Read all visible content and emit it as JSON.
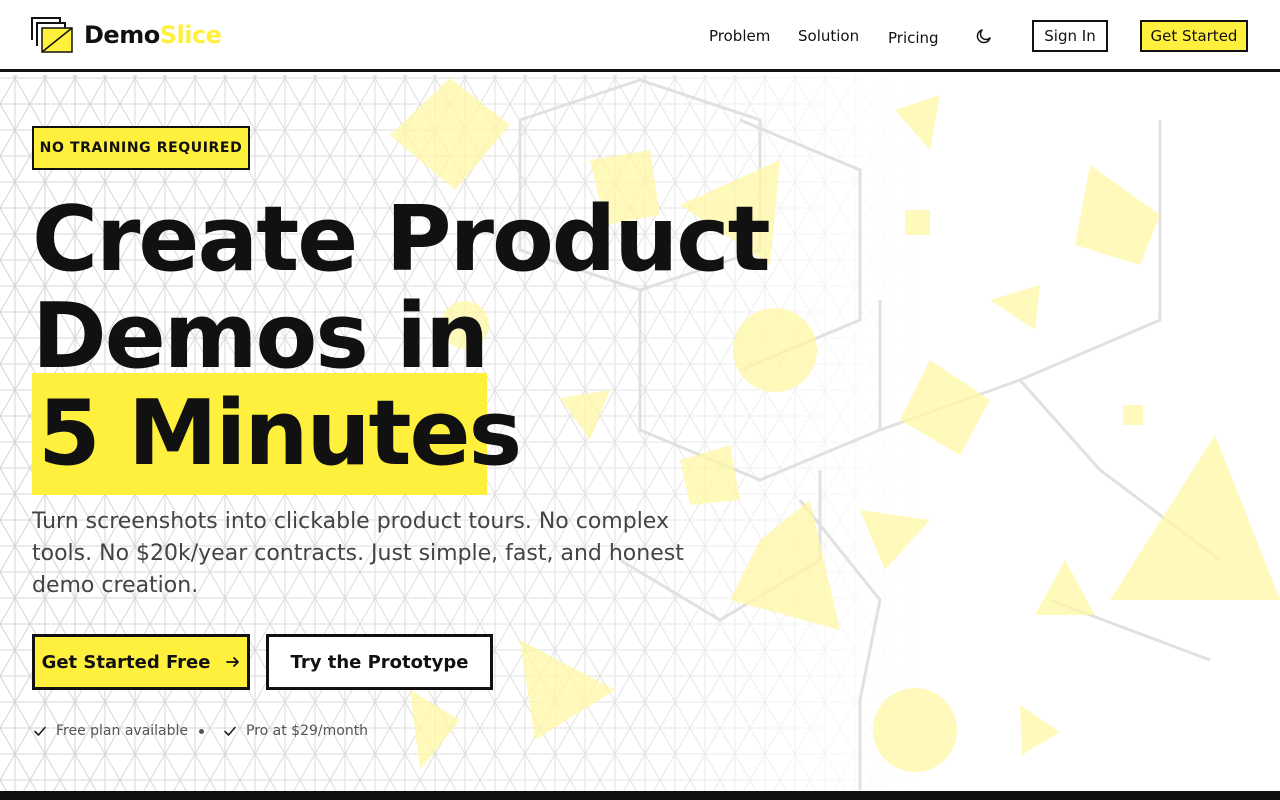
{
  "header": {
    "brand_first": "Demo",
    "brand_second": "Slice",
    "nav": [
      "Problem",
      "Solution",
      "Pricing"
    ],
    "sign_in": "Sign In",
    "get_started": "Get Started"
  },
  "hero": {
    "badge": "NO TRAINING REQUIRED",
    "headline_line1": "Create Product",
    "headline_line2": "Demos in",
    "headline_highlight": "5 Minutes",
    "subtitle": "Turn screenshots into clickable product tours. No complex tools. No $20k/year contracts. Just simple, fast, and honest demo creation.",
    "cta_primary": "Get Started Free",
    "cta_secondary": "Try the Prototype",
    "features": [
      "Free plan available",
      "Pro at $29/month"
    ]
  },
  "icons": {
    "logo": "stacked-frames-logo-icon",
    "theme_toggle": "moon-icon",
    "cta_arrow": "arrow-right-icon",
    "feature_check": "check-icon"
  },
  "colors": {
    "accent": "#fff03e",
    "ink": "#111111",
    "muted_text": "#444444"
  }
}
